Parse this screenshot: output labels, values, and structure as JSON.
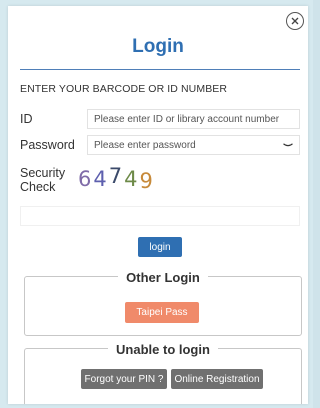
{
  "login": {
    "title": "Login",
    "instructions": "ENTER YOUR BARCODE OR ID NUMBER",
    "id_label": "ID",
    "id_placeholder": "Please enter ID or library account number",
    "password_label": "Password",
    "password_placeholder": "Please enter password",
    "security_label_line1": "Security",
    "security_label_line2": "Check",
    "captcha_digits": [
      "6",
      "4",
      "7",
      "4",
      "9"
    ],
    "captcha_colors": [
      "#7f6ba8",
      "#5d5fae",
      "#3b4a6a",
      "#6d8a48",
      "#c78a3a"
    ],
    "login_button": "login"
  },
  "other_login": {
    "title": "Other Login",
    "taipei_pass_button": "Taipei Pass"
  },
  "unable": {
    "title": "Unable to login",
    "forgot_pin_button": "Forgot your PIN ?",
    "online_registration_button": "Online Registration"
  },
  "colors": {
    "title_blue": "#2f6fb2",
    "login_button": "#2f6fb2",
    "taipei_pass": "#f08a6a",
    "secondary_button": "#707070"
  }
}
